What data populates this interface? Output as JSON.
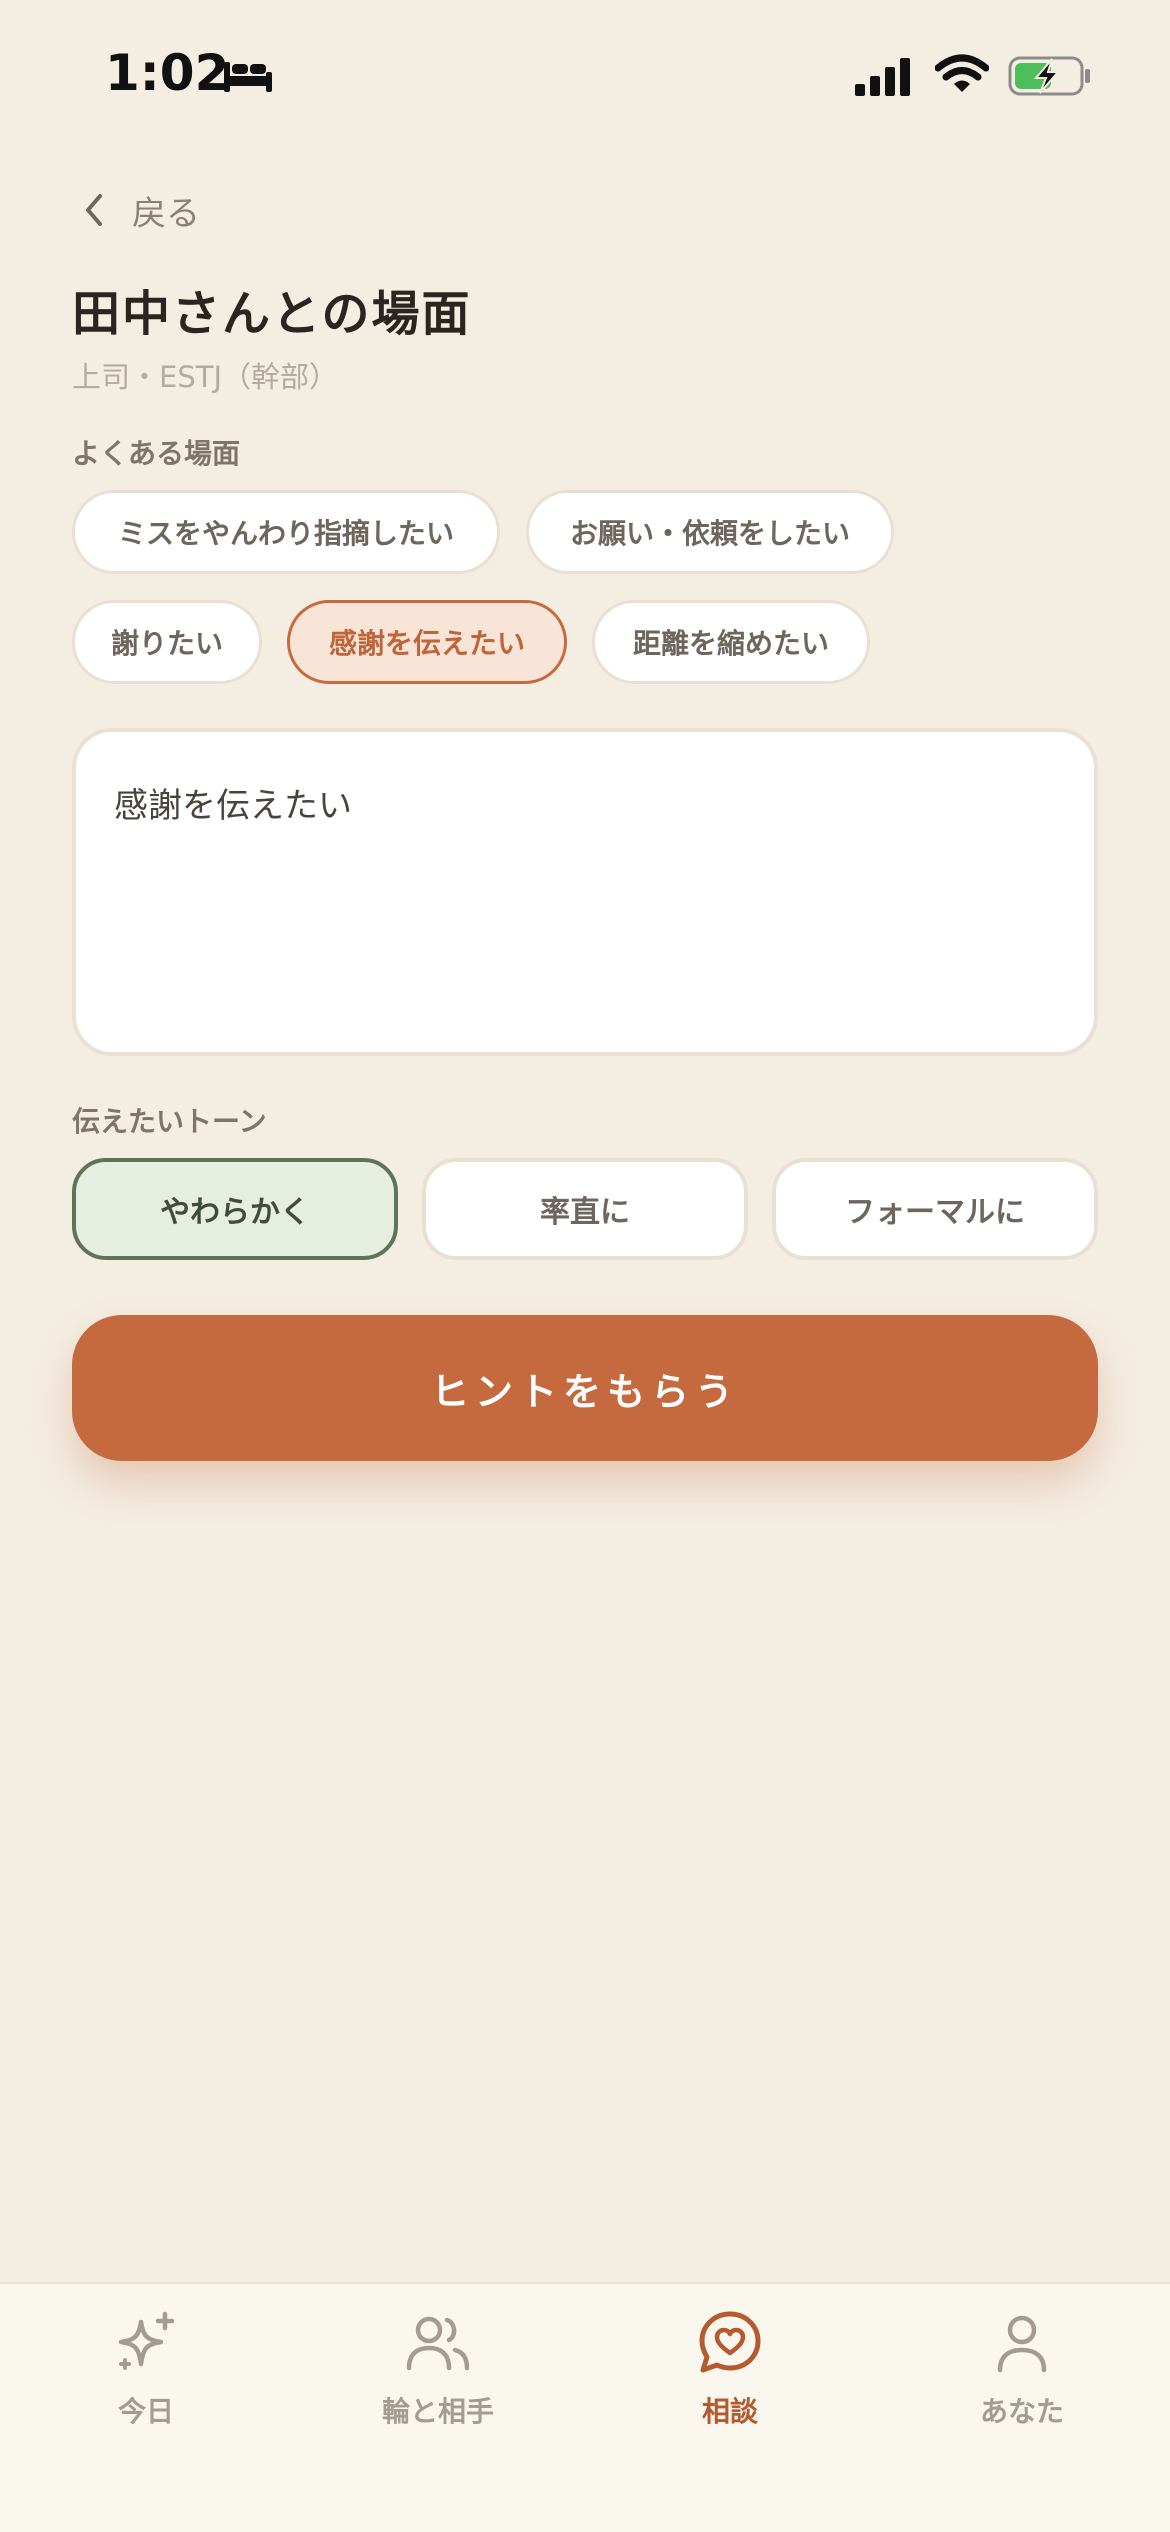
{
  "status_bar": {
    "time": "1:02"
  },
  "nav": {
    "back_label": "戻る"
  },
  "header": {
    "title": "田中さんとの場面",
    "subtitle": "上司・ESTJ（幹部）"
  },
  "scenes": {
    "label": "よくある場面",
    "chips": [
      {
        "label": "ミスをやんわり指摘したい",
        "selected": false
      },
      {
        "label": "お願い・依頼をしたい",
        "selected": false
      },
      {
        "label": "謝りたい",
        "selected": false
      },
      {
        "label": "感謝を伝えたい",
        "selected": true
      },
      {
        "label": "距離を縮めたい",
        "selected": false
      }
    ]
  },
  "message": {
    "value": "感謝を伝えたい"
  },
  "tone": {
    "label": "伝えたいトーン",
    "options": [
      {
        "label": "やわらかく",
        "selected": true
      },
      {
        "label": "率直に",
        "selected": false
      },
      {
        "label": "フォーマルに",
        "selected": false
      }
    ]
  },
  "cta": {
    "label": "ヒントをもらう"
  },
  "tabbar": {
    "items": [
      {
        "label": "今日",
        "icon": "sparkle-icon",
        "active": false
      },
      {
        "label": "輪と相手",
        "icon": "people-icon",
        "active": false
      },
      {
        "label": "相談",
        "icon": "chat-heart-icon",
        "active": true
      },
      {
        "label": "あなた",
        "icon": "person-icon",
        "active": false
      }
    ]
  },
  "colors": {
    "background": "#F4EDE2",
    "accent": "#C46A3E",
    "tone_selected": "#E5EEDF"
  }
}
